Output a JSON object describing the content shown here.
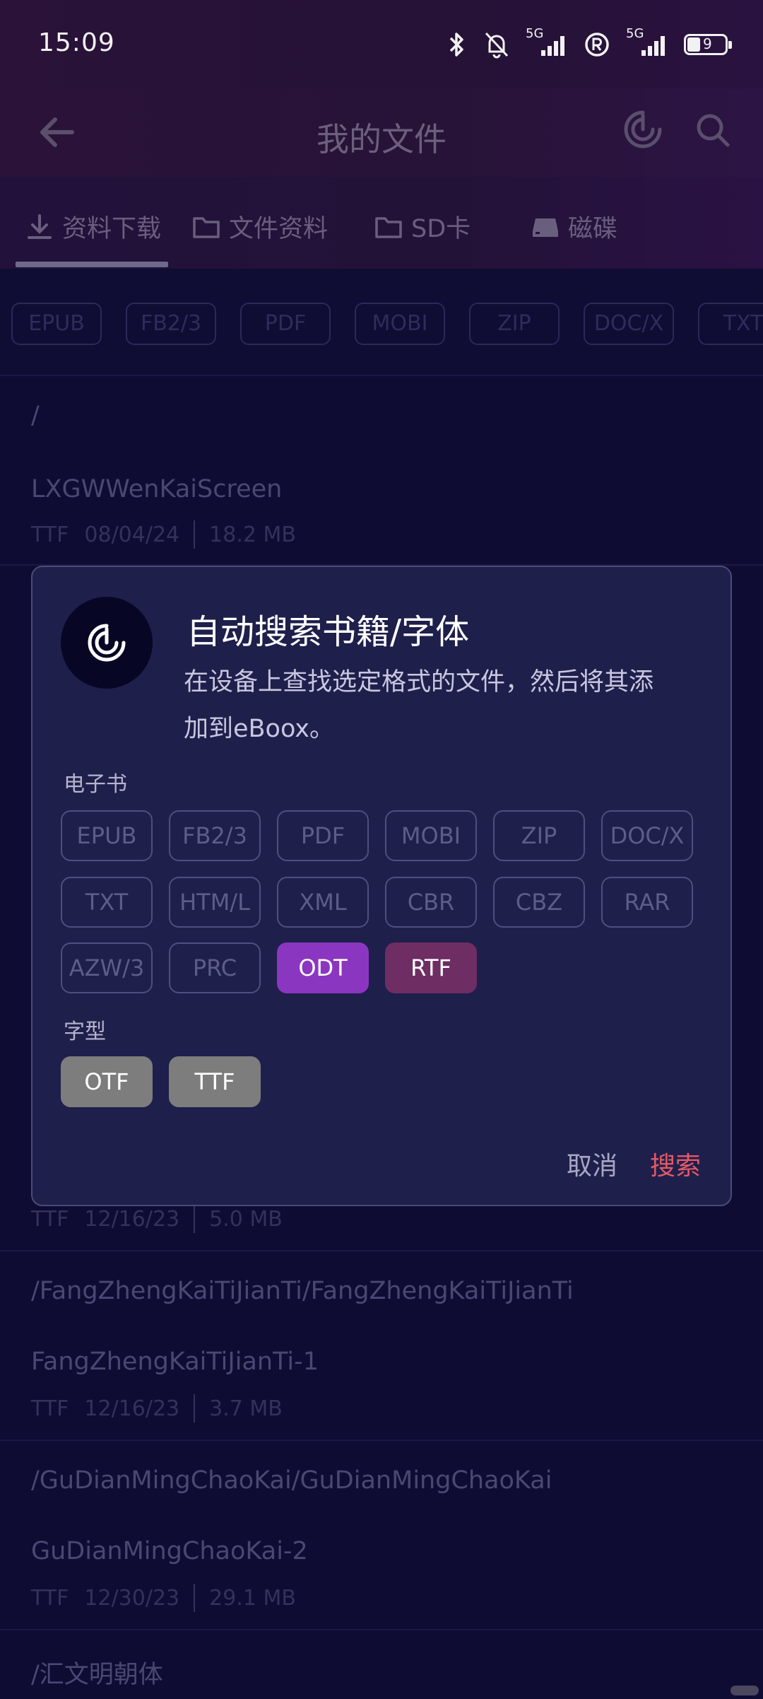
{
  "status_bar": {
    "time": "15:09",
    "battery_level": "9",
    "network_a": "5G",
    "network_b": "5G",
    "icons": [
      "bluetooth-icon",
      "bell-muted-icon",
      "signal-icon",
      "registered-icon",
      "signal-icon",
      "battery-icon"
    ]
  },
  "app_bar": {
    "title": "我的文件",
    "icons": [
      "back-arrow-icon",
      "radar-icon",
      "search-icon"
    ]
  },
  "tabs": [
    {
      "label": "资料下载",
      "icon": "download-icon"
    },
    {
      "label": "文件资料",
      "icon": "folder-icon"
    },
    {
      "label": "SD卡",
      "icon": "folder-icon"
    },
    {
      "label": "磁碟",
      "icon": "drive-icon"
    }
  ],
  "filter_chips": [
    "EPUB",
    "FB2/3",
    "PDF",
    "MOBI",
    "ZIP",
    "DOC/X",
    "TXT"
  ],
  "background_list": {
    "root_path": "/",
    "item1_name": "LXGWWenKaiScreen",
    "item1_type": "TTF",
    "item1_date": "08/04/24",
    "item1_size": "18.2 MB",
    "item2_type": "TTF",
    "item2_date": "12/16/23",
    "item2_size": "5.0 MB",
    "path2": "/FangZhengKaiTiJianTi/FangZhengKaiTiJianTi",
    "item3_name": "FangZhengKaiTiJianTi-1",
    "item3_type": "TTF",
    "item3_date": "12/16/23",
    "item3_size": "3.7 MB",
    "path3": "/GuDianMingChaoKai/GuDianMingChaoKai",
    "item4_name": "GuDianMingChaoKai-2",
    "item4_type": "TTF",
    "item4_date": "12/30/23",
    "item4_size": "29.1 MB",
    "path4": "/汇文明朝体"
  },
  "dialog": {
    "title": "自动搜索书籍/字体",
    "description_line1": "在设备上查找选定格式的文件，然后将其添",
    "description_line2": "加到eBoox。",
    "ebook_label": "电子书",
    "ebook_formats": [
      "EPUB",
      "FB2/3",
      "PDF",
      "MOBI",
      "ZIP",
      "DOC/X",
      "TXT",
      "HTM/L",
      "XML",
      "CBR",
      "CBZ",
      "RAR",
      "AZW/3",
      "PRC",
      "ODT",
      "RTF"
    ],
    "selected_ebook_formats": [
      "ODT",
      "RTF"
    ],
    "font_label": "字型",
    "font_formats": [
      "OTF",
      "TTF"
    ],
    "cancel_label": "取消",
    "search_label": "搜索",
    "accent_color": "#e35a66"
  }
}
